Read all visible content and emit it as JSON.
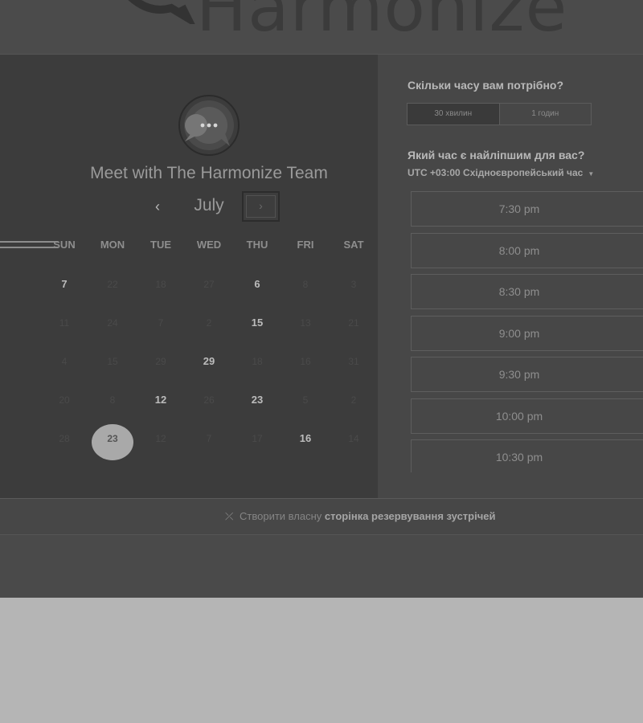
{
  "brand": {
    "name": "Harmonize",
    "logo_icon": "harmonize-logo-icon"
  },
  "calendar": {
    "team_name": "Meet with The Harmonize Team",
    "month": "July",
    "prev_icon": "‹",
    "next_icon": "›",
    "weekdays": [
      "SUN",
      "MON",
      "TUE",
      "WED",
      "THU",
      "FRI",
      "SAT"
    ],
    "weeks": [
      [
        {
          "d": "7",
          "a": true
        },
        {
          "d": "22",
          "a": false
        },
        {
          "d": "18",
          "a": false
        },
        {
          "d": "27",
          "a": false
        },
        {
          "d": "6",
          "a": true
        },
        {
          "d": "8",
          "a": false
        },
        {
          "d": "3",
          "a": false
        }
      ],
      [
        {
          "d": "11",
          "a": false
        },
        {
          "d": "24",
          "a": false
        },
        {
          "d": "7",
          "a": false
        },
        {
          "d": "2",
          "a": false
        },
        {
          "d": "15",
          "a": true
        },
        {
          "d": "13",
          "a": false
        },
        {
          "d": "21",
          "a": false
        }
      ],
      [
        {
          "d": "4",
          "a": false
        },
        {
          "d": "15",
          "a": false
        },
        {
          "d": "29",
          "a": false
        },
        {
          "d": "29",
          "a": true
        },
        {
          "d": "18",
          "a": false
        },
        {
          "d": "16",
          "a": false
        },
        {
          "d": "31",
          "a": false
        }
      ],
      [
        {
          "d": "20",
          "a": false
        },
        {
          "d": "8",
          "a": false
        },
        {
          "d": "12",
          "a": true
        },
        {
          "d": "26",
          "a": false
        },
        {
          "d": "23",
          "a": true
        },
        {
          "d": "5",
          "a": false
        },
        {
          "d": "2",
          "a": false
        }
      ],
      [
        {
          "d": "28",
          "a": false
        },
        {
          "d": "23",
          "a": false,
          "sel": true
        },
        {
          "d": "12",
          "a": false
        },
        {
          "d": "7",
          "a": false
        },
        {
          "d": "17",
          "a": false
        },
        {
          "d": "16",
          "a": true
        },
        {
          "d": "14",
          "a": false
        }
      ]
    ]
  },
  "duration": {
    "question": "Скільки часу вам потрібно?",
    "options": [
      "30 хвилин",
      "1 годин"
    ],
    "selected": 0
  },
  "time": {
    "question": "Який час є найліпшим для вас?",
    "timezone": "UTC +03:00 Східноєвропейський час",
    "slots": [
      "7:30 pm",
      "8:00 pm",
      "8:30 pm",
      "9:00 pm",
      "9:30 pm",
      "10:00 pm",
      "10:30 pm"
    ]
  },
  "footer": {
    "prefix": "Створити власну",
    "link": "сторінка резервування зустрічей",
    "icon": "wand-icon"
  }
}
